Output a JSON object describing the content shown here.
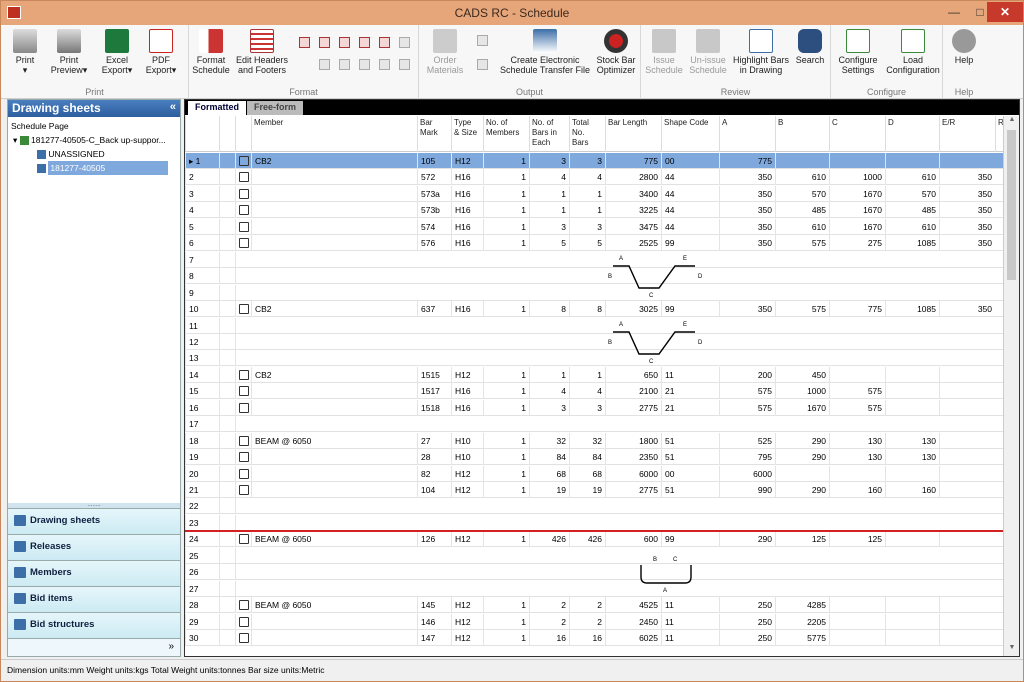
{
  "window": {
    "title": "CADS RC - Schedule",
    "min": "—",
    "max": "□",
    "close": "✕"
  },
  "ribbon": {
    "groups": [
      {
        "label": "Print"
      },
      {
        "label": "Format"
      },
      {
        "label": "Output"
      },
      {
        "label": "Review"
      },
      {
        "label": "Configure"
      },
      {
        "label": "Help"
      }
    ],
    "buttons": {
      "print": "Print",
      "print_preview": "Print\nPreview",
      "excel_export": "Excel\nExport",
      "pdf_export": "PDF\nExport",
      "format_schedule": "Format\nSchedule",
      "edit_headers": "Edit Headers\nand Footers",
      "order_materials": "Order\nMaterials",
      "create_electronic": "Create Electronic\nSchedule Transfer File",
      "stock_bar": "Stock Bar\nOptimizer",
      "issue_schedule": "Issue\nSchedule",
      "unissue_schedule": "Un-issue\nSchedule",
      "highlight_bars": "Highlight Bars\nin Drawing",
      "search": "Search",
      "configure_settings": "Configure\nSettings",
      "load_configuration": "Load\nConfiguration",
      "help": "Help"
    }
  },
  "left_panel": {
    "title": "Drawing sheets",
    "collapse": "«",
    "tree": {
      "root_label": "Schedule Page",
      "drawing": "181277-40505-C_Back up-suppor...",
      "children": [
        "UNASSIGNED",
        "181277-40505"
      ]
    },
    "nav": [
      "Drawing sheets",
      "Releases",
      "Members",
      "Bid items",
      "Bid structures"
    ],
    "foot_chevron": "»",
    "grip": "........"
  },
  "tabs": {
    "active": "Formatted",
    "inactive": "Free-form"
  },
  "table": {
    "headers": [
      "",
      "",
      "",
      "Member",
      "Bar\nMark",
      "Type\n& Size",
      "No. of\nMembers",
      "No. of\nBars in\nEach",
      "Total\nNo.\nBars",
      "Bar Length",
      "Shape Code",
      "A",
      "B",
      "C",
      "D",
      "E/R",
      "R"
    ],
    "rows": [
      {
        "n": "1",
        "member": "CB2",
        "mark": "105",
        "type": "H12",
        "mem": "1",
        "each": "3",
        "total": "3",
        "len": "775",
        "shape": "00",
        "a": "775",
        "b": "",
        "c": "",
        "d": "",
        "e": "",
        "sel": true,
        "marker": "▸"
      },
      {
        "n": "2",
        "member": "",
        "mark": "572",
        "type": "H16",
        "mem": "1",
        "each": "4",
        "total": "4",
        "len": "2800",
        "shape": "44",
        "a": "350",
        "b": "610",
        "c": "1000",
        "d": "610",
        "e": "350"
      },
      {
        "n": "3",
        "member": "",
        "mark": "573a",
        "type": "H16",
        "mem": "1",
        "each": "1",
        "total": "1",
        "len": "3400",
        "shape": "44",
        "a": "350",
        "b": "570",
        "c": "1670",
        "d": "570",
        "e": "350"
      },
      {
        "n": "4",
        "member": "",
        "mark": "573b",
        "type": "H16",
        "mem": "1",
        "each": "1",
        "total": "1",
        "len": "3225",
        "shape": "44",
        "a": "350",
        "b": "485",
        "c": "1670",
        "d": "485",
        "e": "350"
      },
      {
        "n": "5",
        "member": "",
        "mark": "574",
        "type": "H16",
        "mem": "1",
        "each": "3",
        "total": "3",
        "len": "3475",
        "shape": "44",
        "a": "350",
        "b": "610",
        "c": "1670",
        "d": "610",
        "e": "350"
      },
      {
        "n": "6",
        "member": "",
        "mark": "576",
        "type": "H16",
        "mem": "1",
        "each": "5",
        "total": "5",
        "len": "2525",
        "shape": "99",
        "a": "350",
        "b": "575",
        "c": "275",
        "d": "1085",
        "e": "350"
      },
      {
        "n": "7"
      },
      {
        "n": "8"
      },
      {
        "n": "9"
      },
      {
        "n": "10",
        "member": "CB2",
        "mark": "637",
        "type": "H16",
        "mem": "1",
        "each": "8",
        "total": "8",
        "len": "3025",
        "shape": "99",
        "a": "350",
        "b": "575",
        "c": "775",
        "d": "1085",
        "e": "350"
      },
      {
        "n": "11"
      },
      {
        "n": "12"
      },
      {
        "n": "13"
      },
      {
        "n": "14",
        "member": "CB2",
        "mark": "1515",
        "type": "H12",
        "mem": "1",
        "each": "1",
        "total": "1",
        "len": "650",
        "shape": "11",
        "a": "200",
        "b": "450",
        "c": "",
        "d": "",
        "e": ""
      },
      {
        "n": "15",
        "member": "",
        "mark": "1517",
        "type": "H16",
        "mem": "1",
        "each": "4",
        "total": "4",
        "len": "2100",
        "shape": "21",
        "a": "575",
        "b": "1000",
        "c": "575",
        "d": "",
        "e": ""
      },
      {
        "n": "16",
        "member": "",
        "mark": "1518",
        "type": "H16",
        "mem": "1",
        "each": "3",
        "total": "3",
        "len": "2775",
        "shape": "21",
        "a": "575",
        "b": "1670",
        "c": "575",
        "d": "",
        "e": ""
      },
      {
        "n": "17"
      },
      {
        "n": "18",
        "member": "BEAM @ 6050",
        "mark": "27",
        "type": "H10",
        "mem": "1",
        "each": "32",
        "total": "32",
        "len": "1800",
        "shape": "51",
        "a": "525",
        "b": "290",
        "c": "130",
        "d": "130",
        "e": ""
      },
      {
        "n": "19",
        "member": "",
        "mark": "28",
        "type": "H10",
        "mem": "1",
        "each": "84",
        "total": "84",
        "len": "2350",
        "shape": "51",
        "a": "795",
        "b": "290",
        "c": "130",
        "d": "130",
        "e": ""
      },
      {
        "n": "20",
        "member": "",
        "mark": "82",
        "type": "H12",
        "mem": "1",
        "each": "68",
        "total": "68",
        "len": "6000",
        "shape": "00",
        "a": "6000",
        "b": "",
        "c": "",
        "d": "",
        "e": ""
      },
      {
        "n": "21",
        "member": "",
        "mark": "104",
        "type": "H12",
        "mem": "1",
        "each": "19",
        "total": "19",
        "len": "2775",
        "shape": "51",
        "a": "990",
        "b": "290",
        "c": "160",
        "d": "160",
        "e": ""
      },
      {
        "n": "22"
      },
      {
        "n": "23"
      },
      {
        "n": "24",
        "member": "BEAM @ 6050",
        "mark": "126",
        "type": "H12",
        "mem": "1",
        "each": "426",
        "total": "426",
        "len": "600",
        "shape": "99",
        "a": "290",
        "b": "125",
        "c": "125",
        "d": "",
        "e": ""
      },
      {
        "n": "25"
      },
      {
        "n": "26"
      },
      {
        "n": "27"
      },
      {
        "n": "28",
        "member": "BEAM @ 6050",
        "mark": "145",
        "type": "H12",
        "mem": "1",
        "each": "2",
        "total": "2",
        "len": "4525",
        "shape": "11",
        "a": "250",
        "b": "4285",
        "c": "",
        "d": "",
        "e": ""
      },
      {
        "n": "29",
        "member": "",
        "mark": "146",
        "type": "H12",
        "mem": "1",
        "each": "2",
        "total": "2",
        "len": "2450",
        "shape": "11",
        "a": "250",
        "b": "2205",
        "c": "",
        "d": "",
        "e": ""
      },
      {
        "n": "30",
        "member": "",
        "mark": "147",
        "type": "H12",
        "mem": "1",
        "each": "16",
        "total": "16",
        "len": "6025",
        "shape": "11",
        "a": "250",
        "b": "5775",
        "c": "",
        "d": "",
        "e": ""
      }
    ]
  },
  "diagram_labels": {
    "a": "A",
    "b": "B",
    "c": "C",
    "d": "D",
    "e": "E"
  },
  "status": {
    "text": "Dimension units:mm  Weight units:kgs  Total Weight units:tonnes  Bar size units:Metric"
  },
  "colors": {
    "title_bg": "#e7a57a",
    "selection": "#7fa8dc",
    "red_line": "#d32020"
  }
}
